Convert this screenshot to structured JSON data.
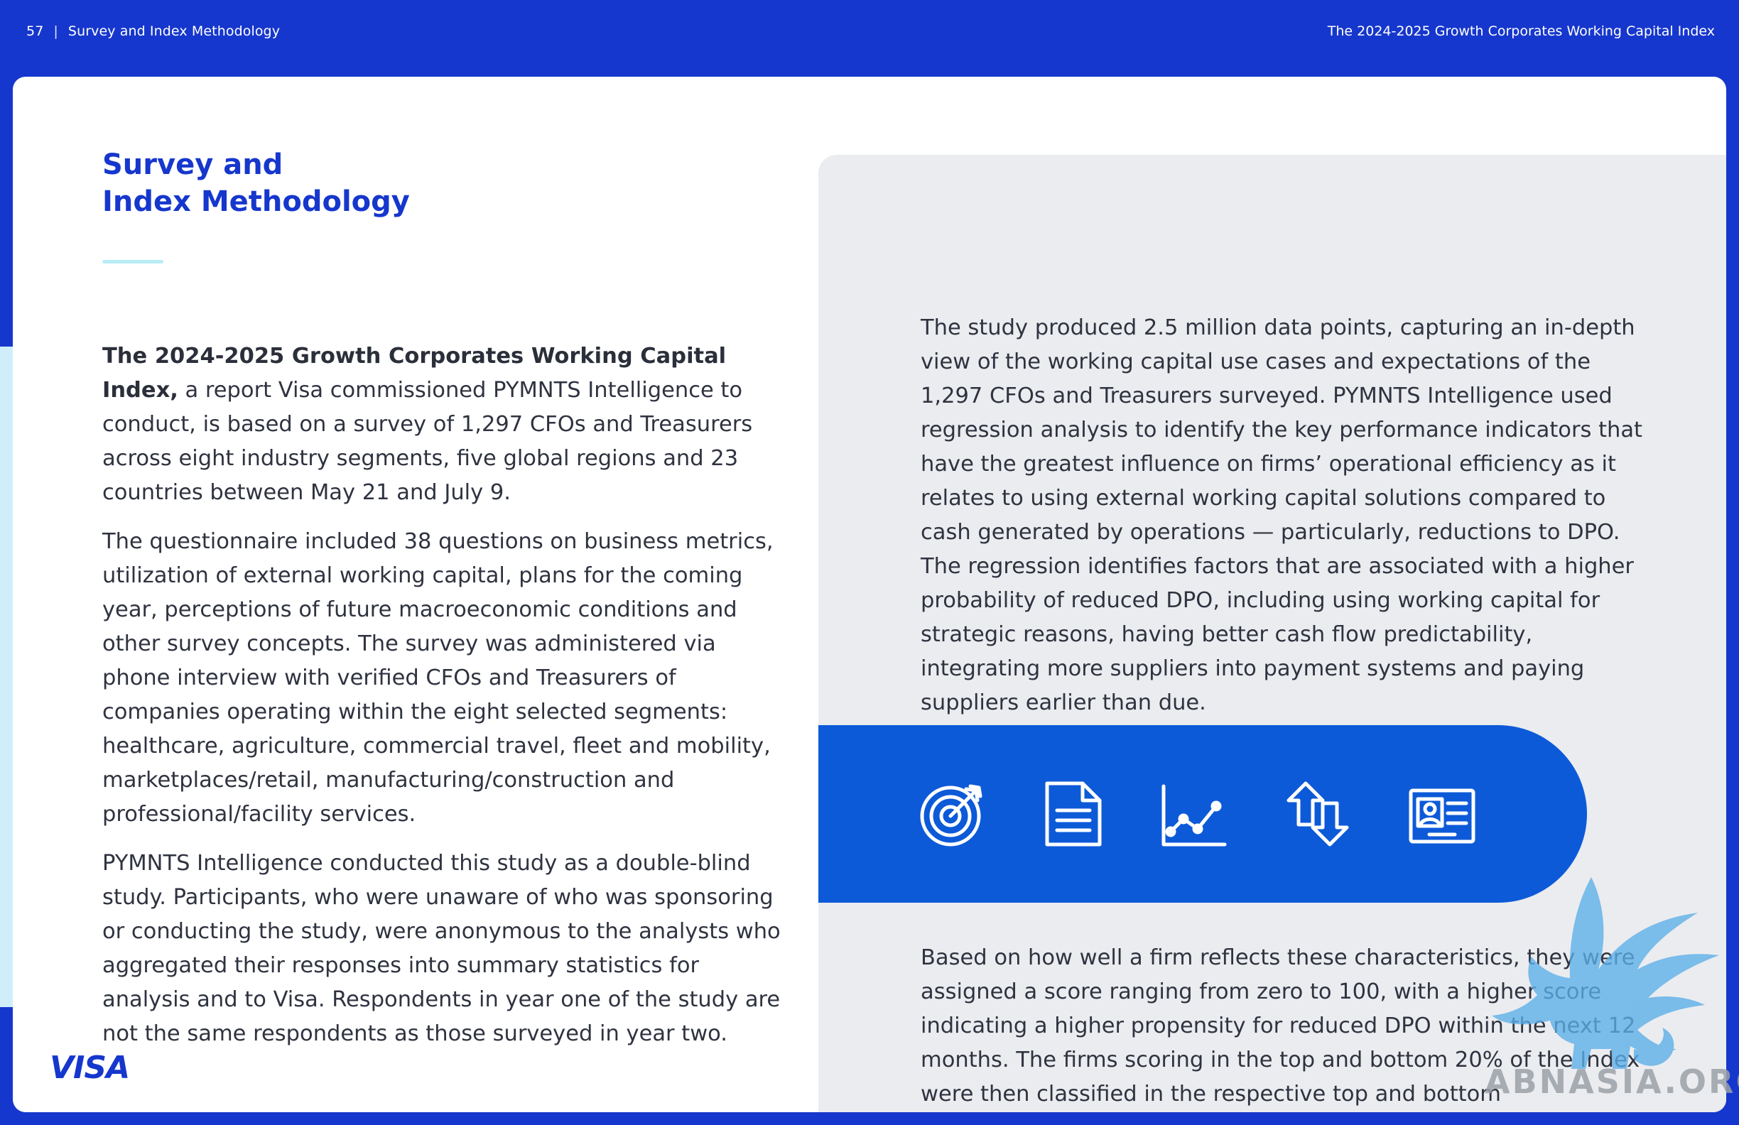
{
  "header": {
    "page_number": "57",
    "separator": "|",
    "section": "Survey and Index Methodology",
    "report_title": "The 2024-2025 Growth Corporates Working Capital Index"
  },
  "section_title": {
    "line1": "Survey and",
    "line2": "Index Methodology"
  },
  "left_column": {
    "para1_bold": "The 2024-2025 Growth Corporates Working Capital Index,",
    "para1_rest": " a report Visa commissioned PYMNTS Intelligence to conduct, is based on a survey of 1,297 CFOs and Treasurers across eight industry segments, five global regions and 23 countries between May 21 and July 9.",
    "para2": "The questionnaire included 38 questions on business metrics, utilization of external working capital, plans for the coming year, perceptions of future macroeconomic conditions and other survey concepts. The survey was administered via phone interview with verified CFOs and Treasurers of companies operating within the eight selected segments: healthcare, agriculture, commercial travel, fleet and mobility, marketplaces/retail, manufacturing/construction and professional/facility services.",
    "para3": "PYMNTS Intelligence conducted this study as a double-blind study. Participants, who were unaware of who was sponsoring or conducting the study, were anonymous to the analysts who aggregated their responses into summary statistics for analysis and to Visa. Respondents in year one of the study are not the same respondents as those surveyed in year two."
  },
  "right_column": {
    "para1": "The study produced 2.5 million data points, capturing an in-depth view of the working capital use cases and expectations of the 1,297 CFOs and Treasurers surveyed. PYMNTS Intelligence used regression analysis to identify the key performance indicators that have the greatest influence on firms’ operational efficiency as it relates to using external working capital solutions compared to cash generated by operations — particularly, reductions to DPO. The regression identifies factors that are associated with a higher probability of reduced DPO, including using working capital for strategic reasons, having better cash flow predictability, integrating more suppliers into payment systems and paying suppliers earlier than due.",
    "para2": "Based on how well a firm reflects these characteristics, they were assigned a score ranging from zero to 100, with a higher score indicating a higher propensity for reduced DPO within the next 12 months. The firms scoring in the top and bottom 20% of the Index were then classified in the respective top and bottom performance tiers."
  },
  "icons": [
    "target-icon",
    "document-icon",
    "line-chart-icon",
    "up-down-arrows-icon",
    "id-card-icon"
  ],
  "footer": {
    "logo": "VISA",
    "watermark": "ABNASIA.ORG"
  },
  "colors": {
    "brand_blue": "#1637cd",
    "band_blue": "#0d5ad8",
    "panel_gray": "#ebecef",
    "accent_cyan": "#b8ecf7"
  }
}
